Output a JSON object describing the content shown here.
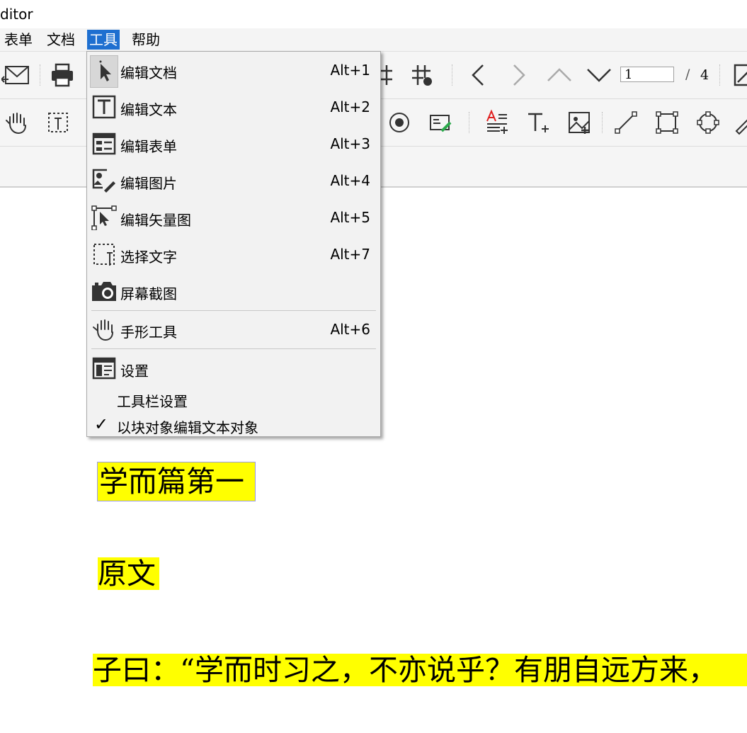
{
  "app": {
    "title_fragment": "ditor"
  },
  "menubar": {
    "items": [
      {
        "label": "表单"
      },
      {
        "label": "文档"
      },
      {
        "label": "工具"
      },
      {
        "label": "帮助"
      }
    ]
  },
  "navigation": {
    "page_input": "1",
    "page_separator": "/",
    "page_total": "4"
  },
  "tools_menu": {
    "items": [
      {
        "label": "编辑文档",
        "shortcut": "Alt+1",
        "icon": "pointer-arrow-icon"
      },
      {
        "label": "编辑文本",
        "shortcut": "Alt+2",
        "icon": "text-box-icon"
      },
      {
        "label": "编辑表单",
        "shortcut": "Alt+3",
        "icon": "form-icon"
      },
      {
        "label": "编辑图片",
        "shortcut": "Alt+4",
        "icon": "image-edit-icon"
      },
      {
        "label": "编辑矢量图",
        "shortcut": "Alt+5",
        "icon": "vector-edit-icon"
      },
      {
        "label": "选择文字",
        "shortcut": "Alt+7",
        "icon": "select-text-icon"
      },
      {
        "label": "屏幕截图",
        "shortcut": "",
        "icon": "camera-icon"
      },
      {
        "label": "手形工具",
        "shortcut": "Alt+6",
        "icon": "hand-icon"
      },
      {
        "label": "设置",
        "shortcut": "",
        "icon": "settings-panel-icon"
      },
      {
        "label": "工具栏设置",
        "shortcut": ""
      },
      {
        "label": "以块对象编辑文本对象",
        "shortcut": "",
        "checked": true
      }
    ]
  },
  "document": {
    "lines": [
      {
        "text": "学而篇第一"
      },
      {
        "text": "原文"
      },
      {
        "text": "子曰：“学而时习之，不亦说乎？有朋自远方来，"
      }
    ]
  },
  "colors": {
    "highlight": "#ffff00",
    "menu_active": "#1e6fd0"
  }
}
